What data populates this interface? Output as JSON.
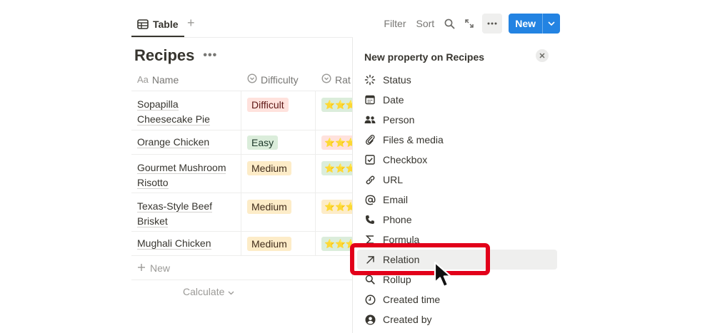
{
  "toolbar": {
    "view_tab_label": "Table",
    "add_view_label": "+",
    "filter_label": "Filter",
    "sort_label": "Sort",
    "new_label": "New",
    "accent_color": "#2383e2"
  },
  "database": {
    "title": "Recipes",
    "more_label": "•••"
  },
  "table": {
    "columns": [
      {
        "label": "Name",
        "prefix": "Aa"
      },
      {
        "label": "Difficulty"
      },
      {
        "label": "Rat"
      }
    ],
    "rows": [
      {
        "name_line1": "Sopapilla",
        "name_line2": "Cheesecake Pie",
        "difficulty": "Difficult",
        "rating": "⭐⭐⭐"
      },
      {
        "name_line1": "Orange Chicken",
        "name_line2": "",
        "difficulty": "Easy",
        "rating": "⭐⭐⭐"
      },
      {
        "name_line1": "Gourmet Mushroom",
        "name_line2": "Risotto",
        "difficulty": "Medium",
        "rating": "⭐⭐⭐"
      },
      {
        "name_line1": "Texas-Style Beef",
        "name_line2": "Brisket",
        "difficulty": "Medium",
        "rating": "⭐⭐⭐"
      },
      {
        "name_line1": "Mughali Chicken",
        "name_line2": "",
        "difficulty": "Medium",
        "rating": "⭐⭐⭐"
      }
    ],
    "new_row_label": "New",
    "calculate_label": "Calculate"
  },
  "tag_colors": {
    "Difficult": {
      "bg": "#ffe2dd",
      "fg": "#5d1715"
    },
    "Easy": {
      "bg": "#dbeddb",
      "fg": "#1c3829"
    },
    "Medium": {
      "bg": "#fdecc8",
      "fg": "#402c1b"
    }
  },
  "rating_colors": [
    "#dbeddb",
    "#ffe2dd",
    "#dbeddb",
    "#fdecc8",
    "#dbeddb"
  ],
  "panel": {
    "title": "New property on Recipes",
    "items": [
      {
        "label": "Status",
        "icon": "status-icon"
      },
      {
        "label": "Date",
        "icon": "calendar-icon"
      },
      {
        "label": "Person",
        "icon": "people-icon"
      },
      {
        "label": "Files & media",
        "icon": "paperclip-icon"
      },
      {
        "label": "Checkbox",
        "icon": "checkbox-icon"
      },
      {
        "label": "URL",
        "icon": "link-icon"
      },
      {
        "label": "Email",
        "icon": "at-icon"
      },
      {
        "label": "Phone",
        "icon": "phone-icon"
      },
      {
        "label": "Formula",
        "icon": "sigma-icon"
      },
      {
        "label": "Relation",
        "icon": "arrow-up-right-icon"
      },
      {
        "label": "Rollup",
        "icon": "search-icon"
      },
      {
        "label": "Created time",
        "icon": "clock-icon"
      },
      {
        "label": "Created by",
        "icon": "user-circle-icon"
      }
    ],
    "highlighted_item": "Relation"
  },
  "annotation": {
    "color": "#e2001a"
  }
}
